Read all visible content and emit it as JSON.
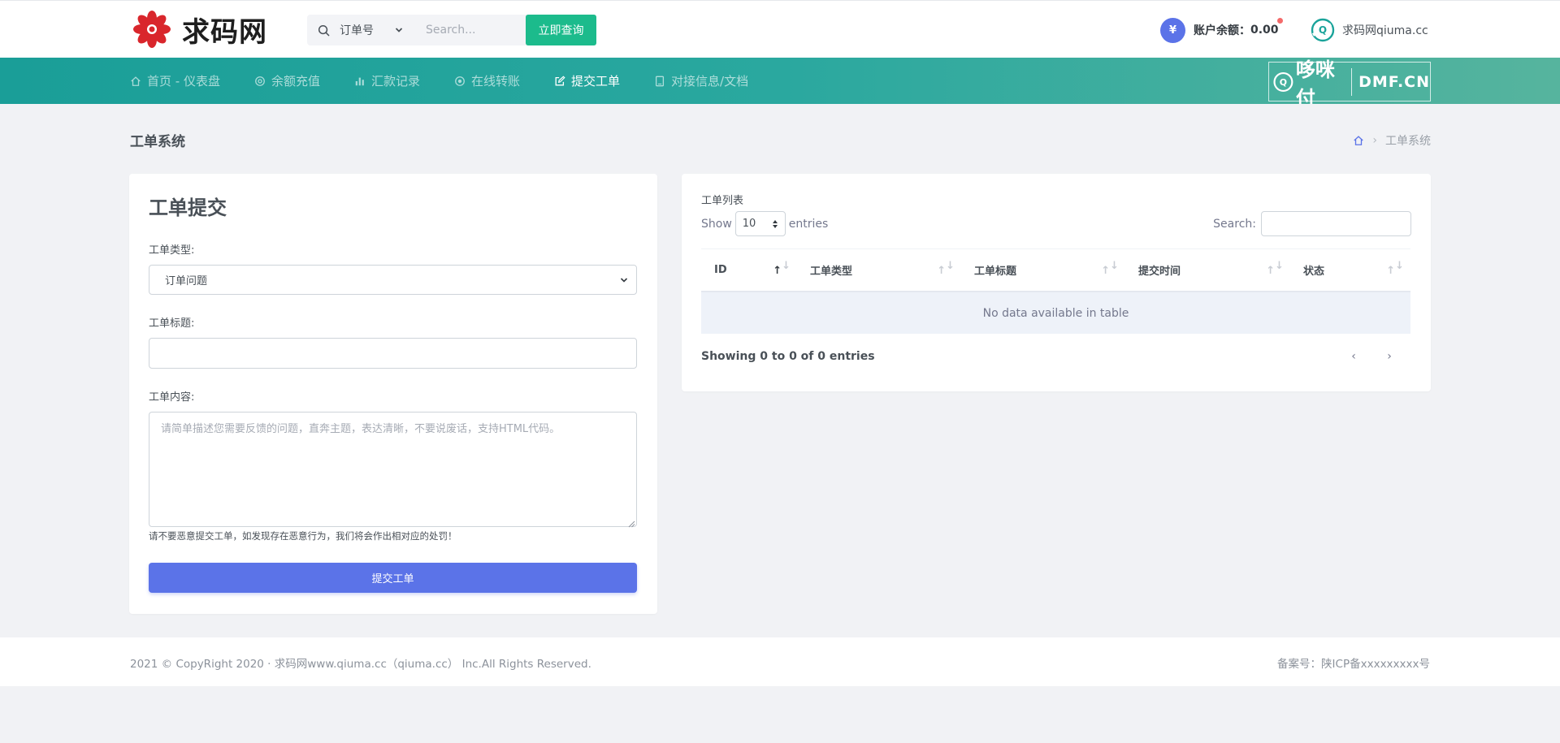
{
  "header": {
    "logo_text": "求码网",
    "search": {
      "select_value": "订单号",
      "placeholder": "Search...",
      "button_label": "立即查询"
    },
    "balance": {
      "icon_glyph": "¥",
      "label": "账户余额：",
      "value": "0.00"
    },
    "user": {
      "name": "求码网qiuma.cc"
    }
  },
  "nav": {
    "items": [
      {
        "label": "首页 - 仪表盘",
        "icon": "home-icon",
        "active": false
      },
      {
        "label": "余额充值",
        "icon": "target-icon",
        "active": false
      },
      {
        "label": "汇款记录",
        "icon": "bar-chart-icon",
        "active": false
      },
      {
        "label": "在线转账",
        "icon": "transfer-icon",
        "active": false
      },
      {
        "label": "提交工单",
        "icon": "edit-icon",
        "active": true
      },
      {
        "label": "对接信息/文档",
        "icon": "book-icon",
        "active": false
      }
    ],
    "partner_text": "哆咪付",
    "partner_domain": "DMF.CN"
  },
  "page": {
    "title": "工单系统",
    "breadcrumb_current": "工单系统"
  },
  "form": {
    "title": "工单提交",
    "type_label": "工单类型:",
    "type_value": "订单问题",
    "subject_label": "工单标题:",
    "subject_value": "",
    "content_label": "工单内容:",
    "content_placeholder": "请简单描述您需要反馈的问题，直奔主题，表达清晰，不要说废话，支持HTML代码。",
    "note": "请不要恶意提交工单，如发现存在恶意行为，我们将会作出相对应的处罚！",
    "submit_label": "提交工单"
  },
  "list": {
    "title": "工单列表",
    "show_label": "Show",
    "entries_value": "10",
    "entries_label": "entries",
    "search_label": "Search:",
    "columns": [
      "ID",
      "工单类型",
      "工单标题",
      "提交时间",
      "状态"
    ],
    "empty_text": "No data available in table",
    "showing_text": "Showing 0 to 0 of 0 entries",
    "prev_glyph": "‹",
    "next_glyph": "›"
  },
  "footer": {
    "copyright": "2021 © CopyRight 2020 · 求码网www.qiuma.cc（qiuma.cc） Inc.All Rights Reserved.",
    "icp": "备案号：陕ICP备xxxxxxxxx号"
  },
  "colors": {
    "accent": "#5b73e8",
    "search_button": "#1cbb8c",
    "nav_start": "#1a9e98",
    "nav_end": "#56b49e",
    "notification_dot": "#f46a6a"
  }
}
